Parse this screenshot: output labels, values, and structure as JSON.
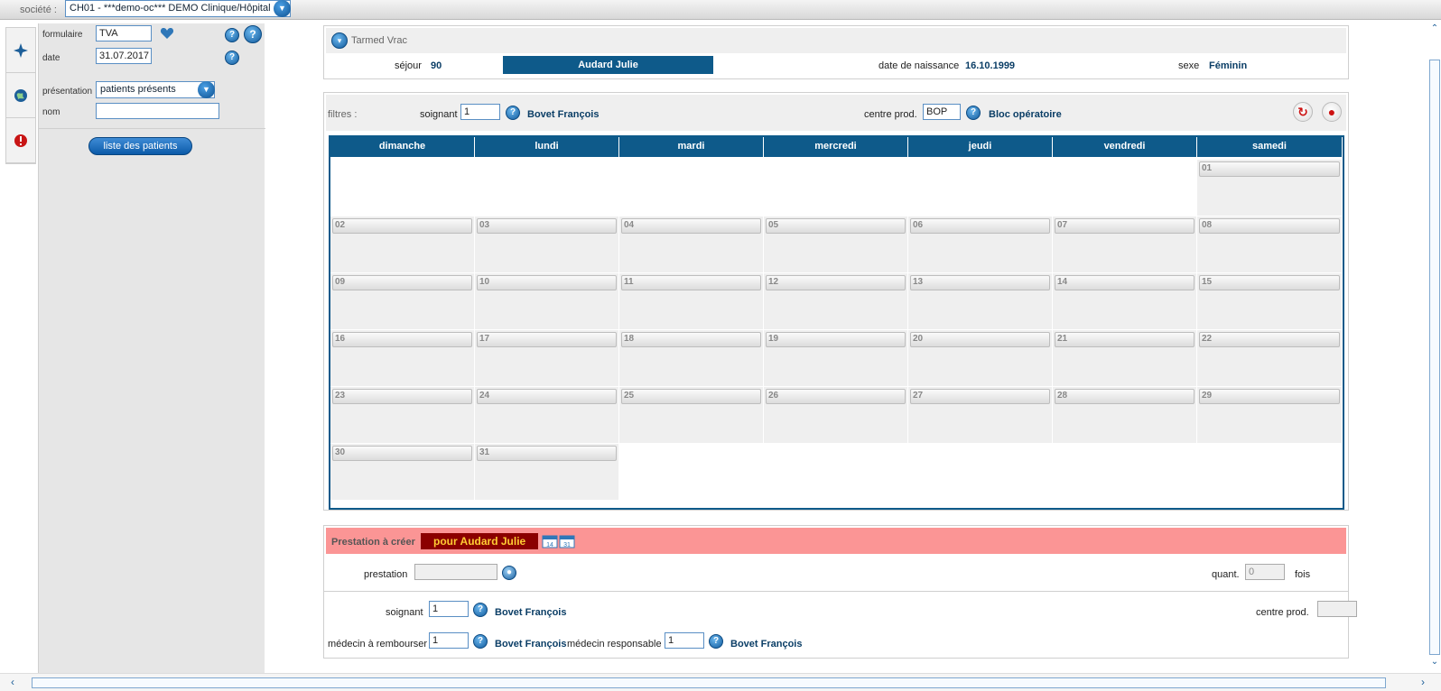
{
  "top": {
    "societe_label": "société :",
    "societe_value": "CH01 - ***demo-oc*** DEMO Clinique/Hôpital"
  },
  "left": {
    "formulaire_label": "formulaire",
    "formulaire_value": "TVA",
    "date_label": "date",
    "date_value": "31.07.2017",
    "presentation_label": "présentation",
    "presentation_value": "patients présents",
    "nom_label": "nom",
    "nom_value": "",
    "patients_button": "liste des patients"
  },
  "patient": {
    "module_title": "Tarmed Vrac",
    "sejour_label": "séjour",
    "sejour_value": "90",
    "name": "Audard Julie",
    "dob_label": "date de naissance",
    "dob_value": "16.10.1999",
    "sexe_label": "sexe",
    "sexe_value": "Féminin"
  },
  "filters": {
    "filtres_label": "filtres :",
    "soignant_label": "soignant",
    "soignant_value": "1",
    "soignant_name": "Bovet François",
    "centre_label": "centre prod.",
    "centre_value": "BOP",
    "centre_name": "Bloc opératoire"
  },
  "calendar": {
    "days": [
      "dimanche",
      "lundi",
      "mardi",
      "mercredi",
      "jeudi",
      "vendredi",
      "samedi"
    ],
    "weeks": [
      [
        "",
        "",
        "",
        "",
        "",
        "",
        "01"
      ],
      [
        "02",
        "03",
        "04",
        "05",
        "06",
        "07",
        "08"
      ],
      [
        "09",
        "10",
        "11",
        "12",
        "13",
        "14",
        "15"
      ],
      [
        "16",
        "17",
        "18",
        "19",
        "20",
        "21",
        "22"
      ],
      [
        "23",
        "24",
        "25",
        "26",
        "27",
        "28",
        "29"
      ],
      [
        "30",
        "31",
        "",
        "",
        "",
        "",
        ""
      ]
    ]
  },
  "prestation": {
    "header_label": "Prestation à créer",
    "header_for": "pour Audard Julie",
    "prestation_label": "prestation",
    "prestation_value": "",
    "quant_label": "quant.",
    "quant_value": "0",
    "fois_label": "fois",
    "soignant_label": "soignant",
    "soignant_value": "1",
    "soignant_name": "Bovet François",
    "centre_label": "centre prod.",
    "centre_value": "",
    "medecin_rembourser_label": "médecin à rembourser",
    "medecin_rembourser_value": "1",
    "medecin_rembourser_name": "Bovet François",
    "medecin_responsable_label": "médecin responsable",
    "medecin_responsable_value": "1",
    "medecin_responsable_name": "Bovet François"
  },
  "colors": {
    "brand_blue": "#0e5a8a",
    "calendar_cell": "#efefef",
    "prestation_header": "#fb9595",
    "badge_dark_red": "#8b0000",
    "badge_text": "#ffcc33"
  },
  "icons": {
    "rail": [
      "compass-icon",
      "globe-icon",
      "alert-icon"
    ],
    "misc": [
      "heart-icon",
      "help-icon",
      "refresh-icon",
      "record-icon",
      "calendar-icon"
    ]
  }
}
